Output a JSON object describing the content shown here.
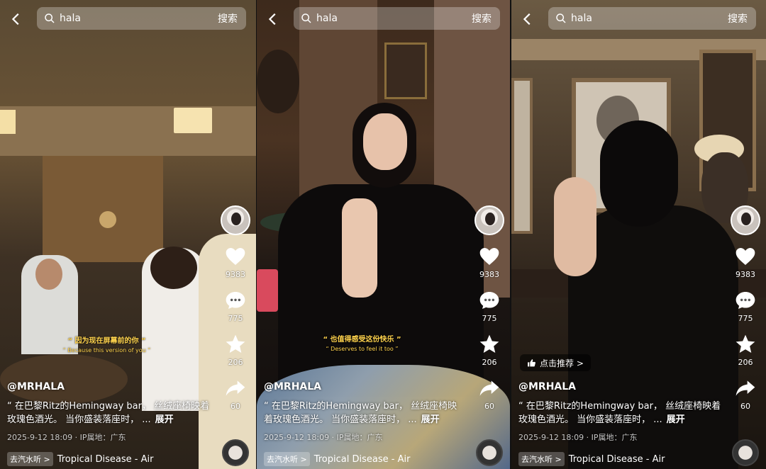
{
  "search": {
    "query": "hala",
    "button": "搜索"
  },
  "posts": [
    {
      "likes": "9383",
      "comments": "775",
      "favorites": "206",
      "shares": "60",
      "subtitle_cn": "“ 因为现在屏幕前的你 ”",
      "subtitle_en": "“ Because this version of you ”",
      "username": "@MRHALA",
      "desc": "“ 在巴黎Ritz的Hemingway bar， 丝绒座椅映着玫瑰色酒光。 当你盛装落座时， ...",
      "more": "展开",
      "meta": "2025-9-12 18:09 · IP属地：广东",
      "music_tag": "去汽水听 >",
      "music": "Tropical Disease - Air"
    },
    {
      "likes": "9383",
      "comments": "775",
      "favorites": "206",
      "shares": "60",
      "subtitle_cn": "“ 也值得感受这份快乐 ”",
      "subtitle_en": "“ Deserves to feel it too ”",
      "username": "@MRHALA",
      "desc": "“ 在巴黎Ritz的Hemingway bar， 丝绒座椅映着玫瑰色酒光。 当你盛装落座时， ...",
      "more": "展开",
      "meta": "2025-9-12 18:09 · IP属地：广东",
      "music_tag": "去汽水听 >",
      "music": "Tropical Disease - Air"
    },
    {
      "likes": "9383",
      "comments": "775",
      "favorites": "206",
      "shares": "60",
      "recommend": "点击推荐 >",
      "username": "@MRHALA",
      "desc": "“ 在巴黎Ritz的Hemingway bar， 丝绒座椅映着玫瑰色酒光。 当你盛装落座时， ...",
      "more": "展开",
      "meta": "2025-9-12 18:09 · IP属地：广东",
      "music_tag": "去汽水听 >",
      "music": "Tropical Disease - Air"
    }
  ],
  "icons": {
    "back": "chevron-left-icon",
    "search": "search-icon",
    "like": "heart-icon",
    "comment": "comment-icon",
    "favorite": "star-icon",
    "share": "share-arrow-icon",
    "recommend": "thumbs-up-icon",
    "music": "music-disc-icon"
  },
  "colors": {
    "subtitle": "#ffd34d",
    "search_bg": "rgba(255,255,255,0.28)"
  }
}
